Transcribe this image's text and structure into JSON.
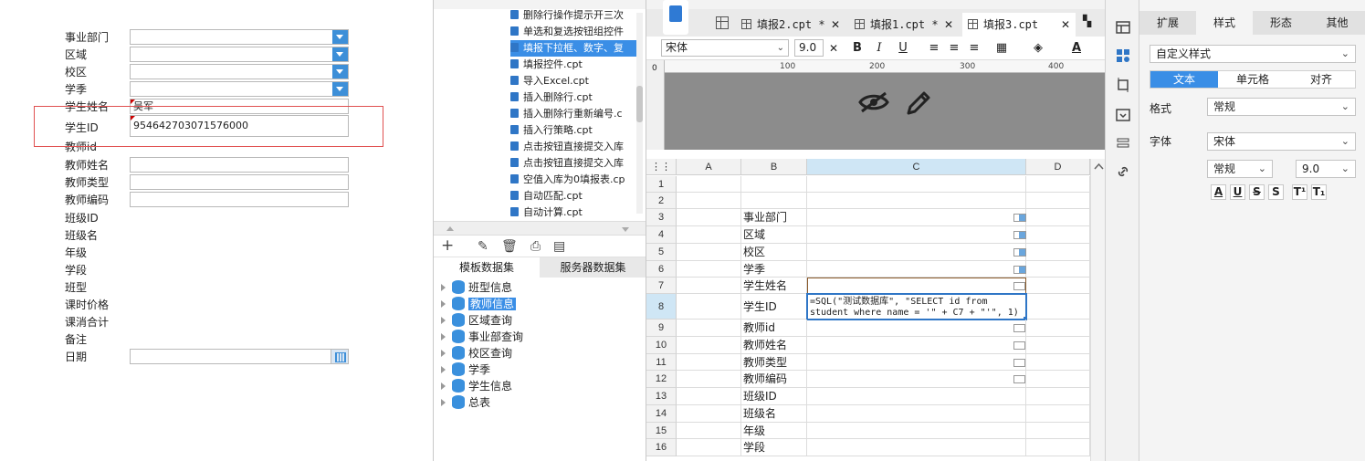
{
  "preview": {
    "fields": [
      {
        "label": "事业部门",
        "value": ""
      },
      {
        "label": "区域",
        "value": ""
      },
      {
        "label": "校区",
        "value": ""
      },
      {
        "label": "学季",
        "value": ""
      },
      {
        "label": "学生姓名",
        "value": "吴军"
      },
      {
        "label": "学生ID",
        "value": "954642703071576000"
      },
      {
        "label": "教师id",
        "value": ""
      },
      {
        "label": "教师姓名",
        "value": ""
      },
      {
        "label": "教师类型",
        "value": ""
      },
      {
        "label": "教师编码",
        "value": ""
      },
      {
        "label": "班级ID",
        "value": ""
      },
      {
        "label": "班级名",
        "value": ""
      },
      {
        "label": "年级",
        "value": ""
      },
      {
        "label": "学段",
        "value": ""
      },
      {
        "label": "班型",
        "value": ""
      },
      {
        "label": "课时价格",
        "value": ""
      },
      {
        "label": "课消合计",
        "value": ""
      },
      {
        "label": "备注",
        "value": ""
      },
      {
        "label": "日期",
        "value": ""
      }
    ]
  },
  "template_tree": {
    "files": [
      {
        "name": "删除行操作提示开三次",
        "selected": false
      },
      {
        "name": "单选和复选按钮组控件",
        "selected": false
      },
      {
        "name": "填报下拉框、数字、复",
        "selected": true
      },
      {
        "name": "填报控件.cpt",
        "selected": false
      },
      {
        "name": "导入Excel.cpt",
        "selected": false
      },
      {
        "name": "插入删除行.cpt",
        "selected": false
      },
      {
        "name": "插入删除行重新编号.c",
        "selected": false
      },
      {
        "name": "插入行策略.cpt",
        "selected": false
      },
      {
        "name": "点击按钮直接提交入库",
        "selected": false
      },
      {
        "name": "点击按钮直接提交入库",
        "selected": false
      },
      {
        "name": "空值入库为0填报表.cp",
        "selected": false
      },
      {
        "name": "自动匹配.cpt",
        "selected": false
      },
      {
        "name": "自动计算.cpt",
        "selected": false
      }
    ]
  },
  "datasets": {
    "tab_template": "模板数据集",
    "tab_server": "服务器数据集",
    "items": [
      {
        "name": "班型信息",
        "selected": false
      },
      {
        "name": "教师信息",
        "selected": true
      },
      {
        "name": "区域查询",
        "selected": false
      },
      {
        "name": "事业部查询",
        "selected": false
      },
      {
        "name": "校区查询",
        "selected": false
      },
      {
        "name": "学季",
        "selected": false
      },
      {
        "name": "学生信息",
        "selected": false
      },
      {
        "name": "总表",
        "selected": false
      }
    ]
  },
  "designer": {
    "tabs": [
      {
        "label": "填报2.cpt *",
        "active": false
      },
      {
        "label": "填报1.cpt *",
        "active": false
      },
      {
        "label": "填报3.cpt",
        "active": true
      }
    ],
    "font_name": "宋体",
    "font_size": "9.0",
    "ruler_ticks": [
      "0",
      "100",
      "200",
      "300",
      "400"
    ],
    "columns": [
      "A",
      "B",
      "C",
      "D"
    ],
    "rows": [
      {
        "n": "1",
        "b": ""
      },
      {
        "n": "2",
        "b": ""
      },
      {
        "n": "3",
        "b": "事业部门"
      },
      {
        "n": "4",
        "b": "区域"
      },
      {
        "n": "5",
        "b": "校区"
      },
      {
        "n": "6",
        "b": "学季"
      },
      {
        "n": "7",
        "b": "学生姓名"
      },
      {
        "n": "8",
        "b": "学生ID"
      },
      {
        "n": "9",
        "b": "教师id"
      },
      {
        "n": "10",
        "b": "教师姓名"
      },
      {
        "n": "11",
        "b": "教师类型"
      },
      {
        "n": "12",
        "b": "教师编码"
      },
      {
        "n": "13",
        "b": "班级ID"
      },
      {
        "n": "14",
        "b": "班级名"
      },
      {
        "n": "15",
        "b": "年级"
      },
      {
        "n": "16",
        "b": "学段"
      }
    ],
    "formula_line1": "=SQL(\"测试数据库\", \"SELECT id from",
    "formula_line2": "student where name = '\" + C7 + \"'\", 1)"
  },
  "props": {
    "tabs": [
      "扩展",
      "样式",
      "形态",
      "其他"
    ],
    "style_preset": "自定义样式",
    "sub_tabs": [
      "文本",
      "单元格",
      "对齐"
    ],
    "format_label": "格式",
    "format_value": "常规",
    "font_label": "字体",
    "font_value": "宋体",
    "font_style": "常规",
    "font_size": "9.0",
    "style_buttons": [
      "A",
      "U",
      "S",
      "S",
      "T¹",
      "T₁"
    ]
  }
}
